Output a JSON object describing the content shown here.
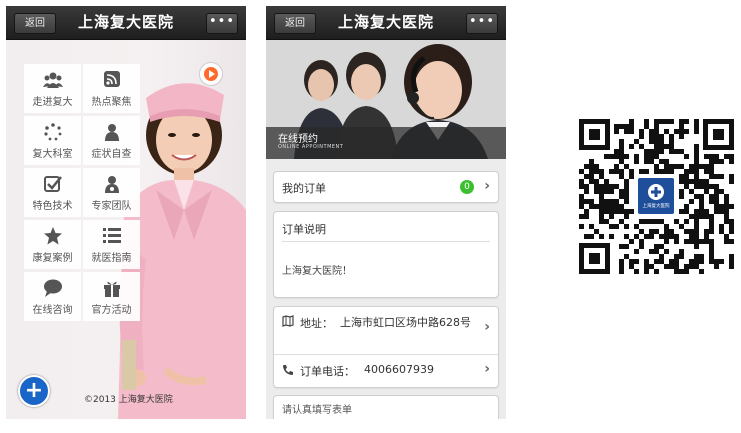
{
  "phone1": {
    "back_label": "返回",
    "title": "上海复大医院",
    "more_label": "•••",
    "tiles": [
      {
        "label": "走进复大",
        "icon": "group-icon"
      },
      {
        "label": "热点聚焦",
        "icon": "rss-icon"
      },
      {
        "label": "复大科室",
        "icon": "spinner-icon"
      },
      {
        "label": "症状自查",
        "icon": "user-icon"
      },
      {
        "label": "特色技术",
        "icon": "checkbox-icon"
      },
      {
        "label": "专家团队",
        "icon": "doctor-icon"
      },
      {
        "label": "康复案例",
        "icon": "star-icon"
      },
      {
        "label": "就医指南",
        "icon": "list-icon"
      },
      {
        "label": "在线咨询",
        "icon": "chat-icon"
      },
      {
        "label": "官方活动",
        "icon": "gift-icon"
      }
    ],
    "copyright": "©2013 上海复大医院",
    "plus_label": "+"
  },
  "phone2": {
    "back_label": "返回",
    "title": "上海复大医院",
    "more_label": "•••",
    "banner_cn": "在线预约",
    "banner_en": "ONLINE APPOINTMENT",
    "my_orders_label": "我的订单",
    "my_orders_count": "0",
    "notice_title": "订单说明",
    "notice_body": "上海复大医院！",
    "address_label": "地址：",
    "address_value": "上海市虹口区场中路628号",
    "phone_label": "订单电话：",
    "phone_value": "4006607939",
    "form_hint": "请认真填写表单"
  },
  "qr": {
    "logo_text": "上海复大医院"
  },
  "colors": {
    "accent_blue": "#1a66c8",
    "badge_green": "#3bbf2f",
    "topbar": "#2a2a2a"
  }
}
